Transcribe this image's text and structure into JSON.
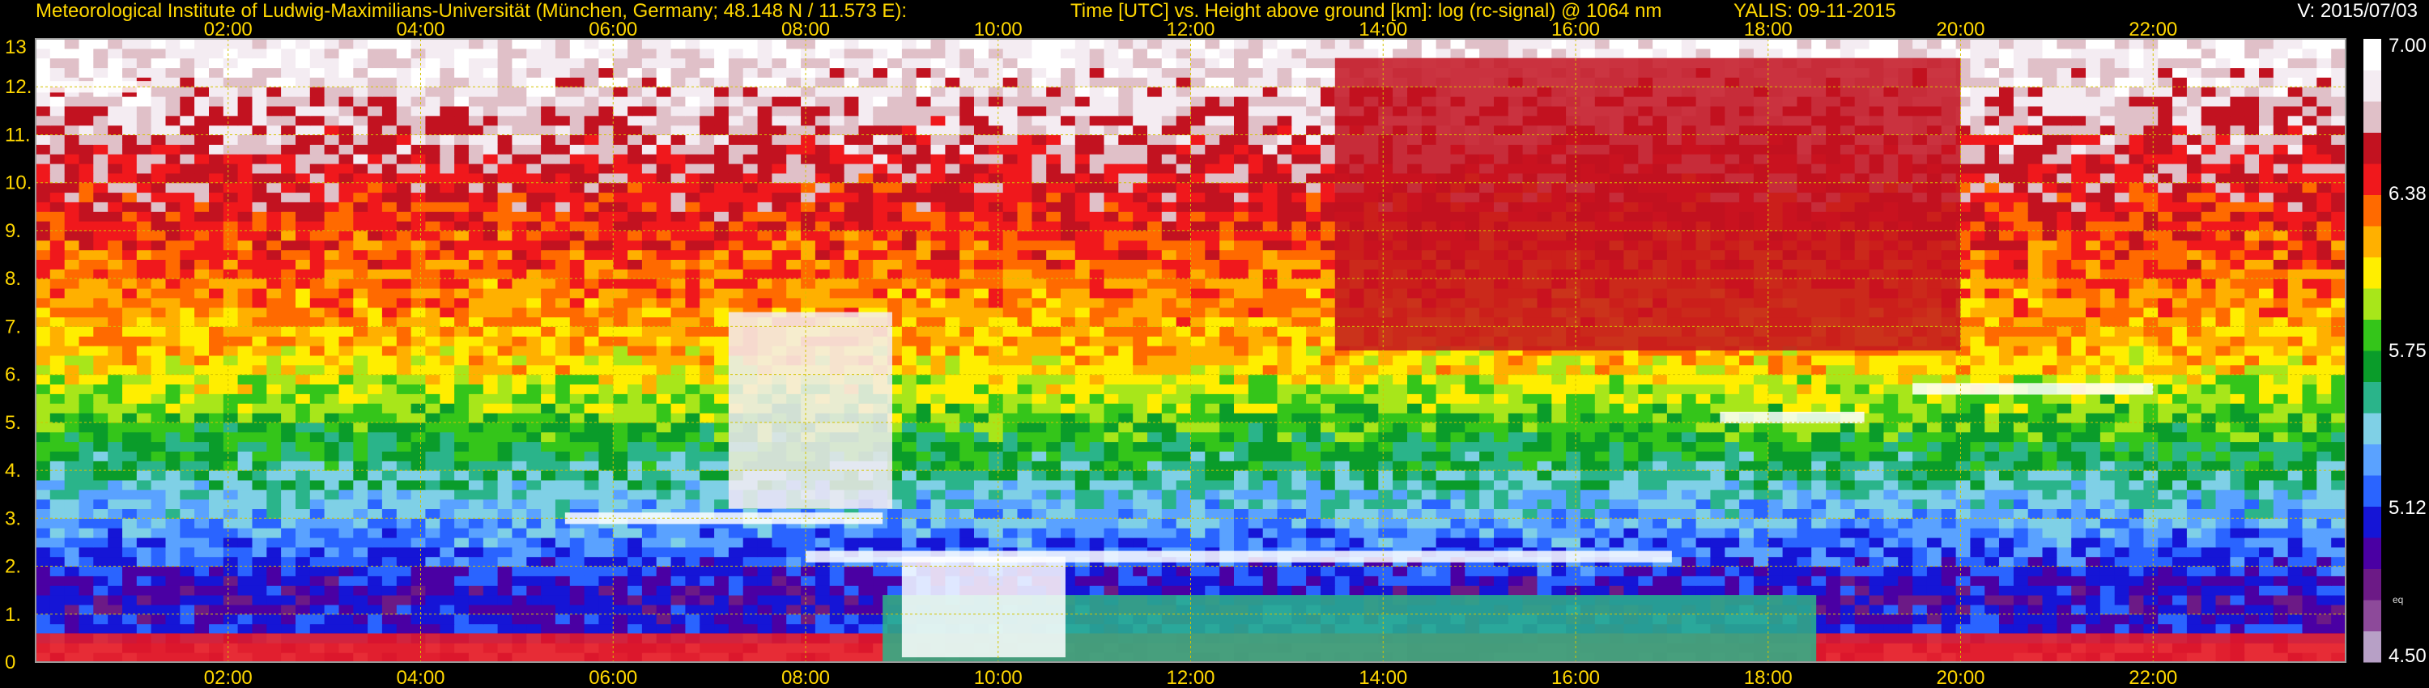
{
  "header": {
    "institute": "Meteorological Institute of Ludwig-Maximilians-Universität (München, Germany; 48.148 N / 11.573 E):",
    "title": "Time [UTC] vs. Height above ground [km]: log (rc-signal) @ 1064 nm",
    "instrument_date": "YALIS: 09-11-2015",
    "version": "V: 2015/07/03"
  },
  "colors": {
    "background": "#000000",
    "header_text": "#ffd700",
    "axis_text": "#ffd700",
    "grid": "#d4c400",
    "frame": "#9a9a9a"
  },
  "chart_data": {
    "type": "heatmap",
    "xlabel": "Time [UTC]",
    "ylabel": "Height above ground [km]",
    "x_unit": "hours UTC",
    "xlim": [
      0,
      24
    ],
    "ylim": [
      0,
      13
    ],
    "x_ticks": [
      {
        "value": 2,
        "label": "02:00"
      },
      {
        "value": 4,
        "label": "04:00"
      },
      {
        "value": 6,
        "label": "06:00"
      },
      {
        "value": 8,
        "label": "08:00"
      },
      {
        "value": 10,
        "label": "10:00"
      },
      {
        "value": 12,
        "label": "12:00"
      },
      {
        "value": 14,
        "label": "14:00"
      },
      {
        "value": 16,
        "label": "16:00"
      },
      {
        "value": 18,
        "label": "18:00"
      },
      {
        "value": 20,
        "label": "20:00"
      },
      {
        "value": 22,
        "label": "22:00"
      }
    ],
    "y_ticks": [
      {
        "value": 0,
        "label": "0"
      },
      {
        "value": 1,
        "label": "1."
      },
      {
        "value": 2,
        "label": "2."
      },
      {
        "value": 3,
        "label": "3."
      },
      {
        "value": 4,
        "label": "4."
      },
      {
        "value": 5,
        "label": "5."
      },
      {
        "value": 6,
        "label": "6."
      },
      {
        "value": 7,
        "label": "7."
      },
      {
        "value": 8,
        "label": "8."
      },
      {
        "value": 9,
        "label": "9."
      },
      {
        "value": 10,
        "label": "10."
      },
      {
        "value": 11,
        "label": "11."
      },
      {
        "value": 12,
        "label": "12."
      },
      {
        "value": 13,
        "label": "13"
      }
    ],
    "grid": true,
    "colorbar": {
      "min": 4.5,
      "max": 7.0,
      "ticks": [
        {
          "value": 7.0,
          "label": "7.00"
        },
        {
          "value": 6.38,
          "label": "6.38"
        },
        {
          "value": 5.75,
          "label": "5.75"
        },
        {
          "value": 5.12,
          "label": "5.12"
        },
        {
          "value": 4.5,
          "label": "4.50"
        }
      ],
      "note": "eq",
      "colors": [
        "#b7a0c6",
        "#8d4a9a",
        "#6c1a86",
        "#4a00a3",
        "#1515d6",
        "#2a64ff",
        "#5aa2ff",
        "#7fd0e6",
        "#2ab48a",
        "#0a9c2a",
        "#34c51a",
        "#a8e61a",
        "#ffee00",
        "#ffb000",
        "#ff6a00",
        "#f0181c",
        "#c21220",
        "#e0c0c8",
        "#f4ecf2",
        "#ffffff"
      ]
    },
    "features": [
      {
        "name": "boundary layer aerosol",
        "x_start": 0,
        "x_end": 24,
        "top_km": 0.6,
        "value": 6.4
      },
      {
        "name": "polluted boundary layer",
        "x_start": 8.8,
        "x_end": 18.5,
        "top_km": 1.4,
        "value": 5.5
      },
      {
        "name": "convective cloud",
        "x_start": 9.0,
        "x_end": 10.7,
        "base_km": 0.1,
        "top_km": 2.2,
        "value": 7.0
      },
      {
        "name": "boundary layer top clouds",
        "x_start": 8.0,
        "x_end": 17.0,
        "height_km": 2.2,
        "value": 7.0
      },
      {
        "name": "mid-level cloud",
        "x_start": 5.5,
        "x_end": 8.8,
        "height_km": 3.0,
        "value": 7.0
      },
      {
        "name": "descending virga",
        "x_start": 7.2,
        "x_end": 8.9,
        "base_km": 3.2,
        "top_km": 7.3,
        "value": 6.8
      },
      {
        "name": "altocumulus",
        "x_start": 19.5,
        "x_end": 22.0,
        "height_km": 5.7,
        "value": 7.0
      },
      {
        "name": "altocumulus",
        "x_start": 17.5,
        "x_end": 19.0,
        "height_km": 5.1,
        "value": 7.0
      },
      {
        "name": "cirrus fall streaks",
        "x_start": 13.5,
        "x_end": 20.0,
        "base_km": 6.5,
        "top_km": 12.6,
        "value": 6.6
      },
      {
        "name": "cirrus",
        "x_start": 0,
        "x_end": 1.2,
        "height_km": 12.0,
        "value": 7.0
      }
    ]
  }
}
